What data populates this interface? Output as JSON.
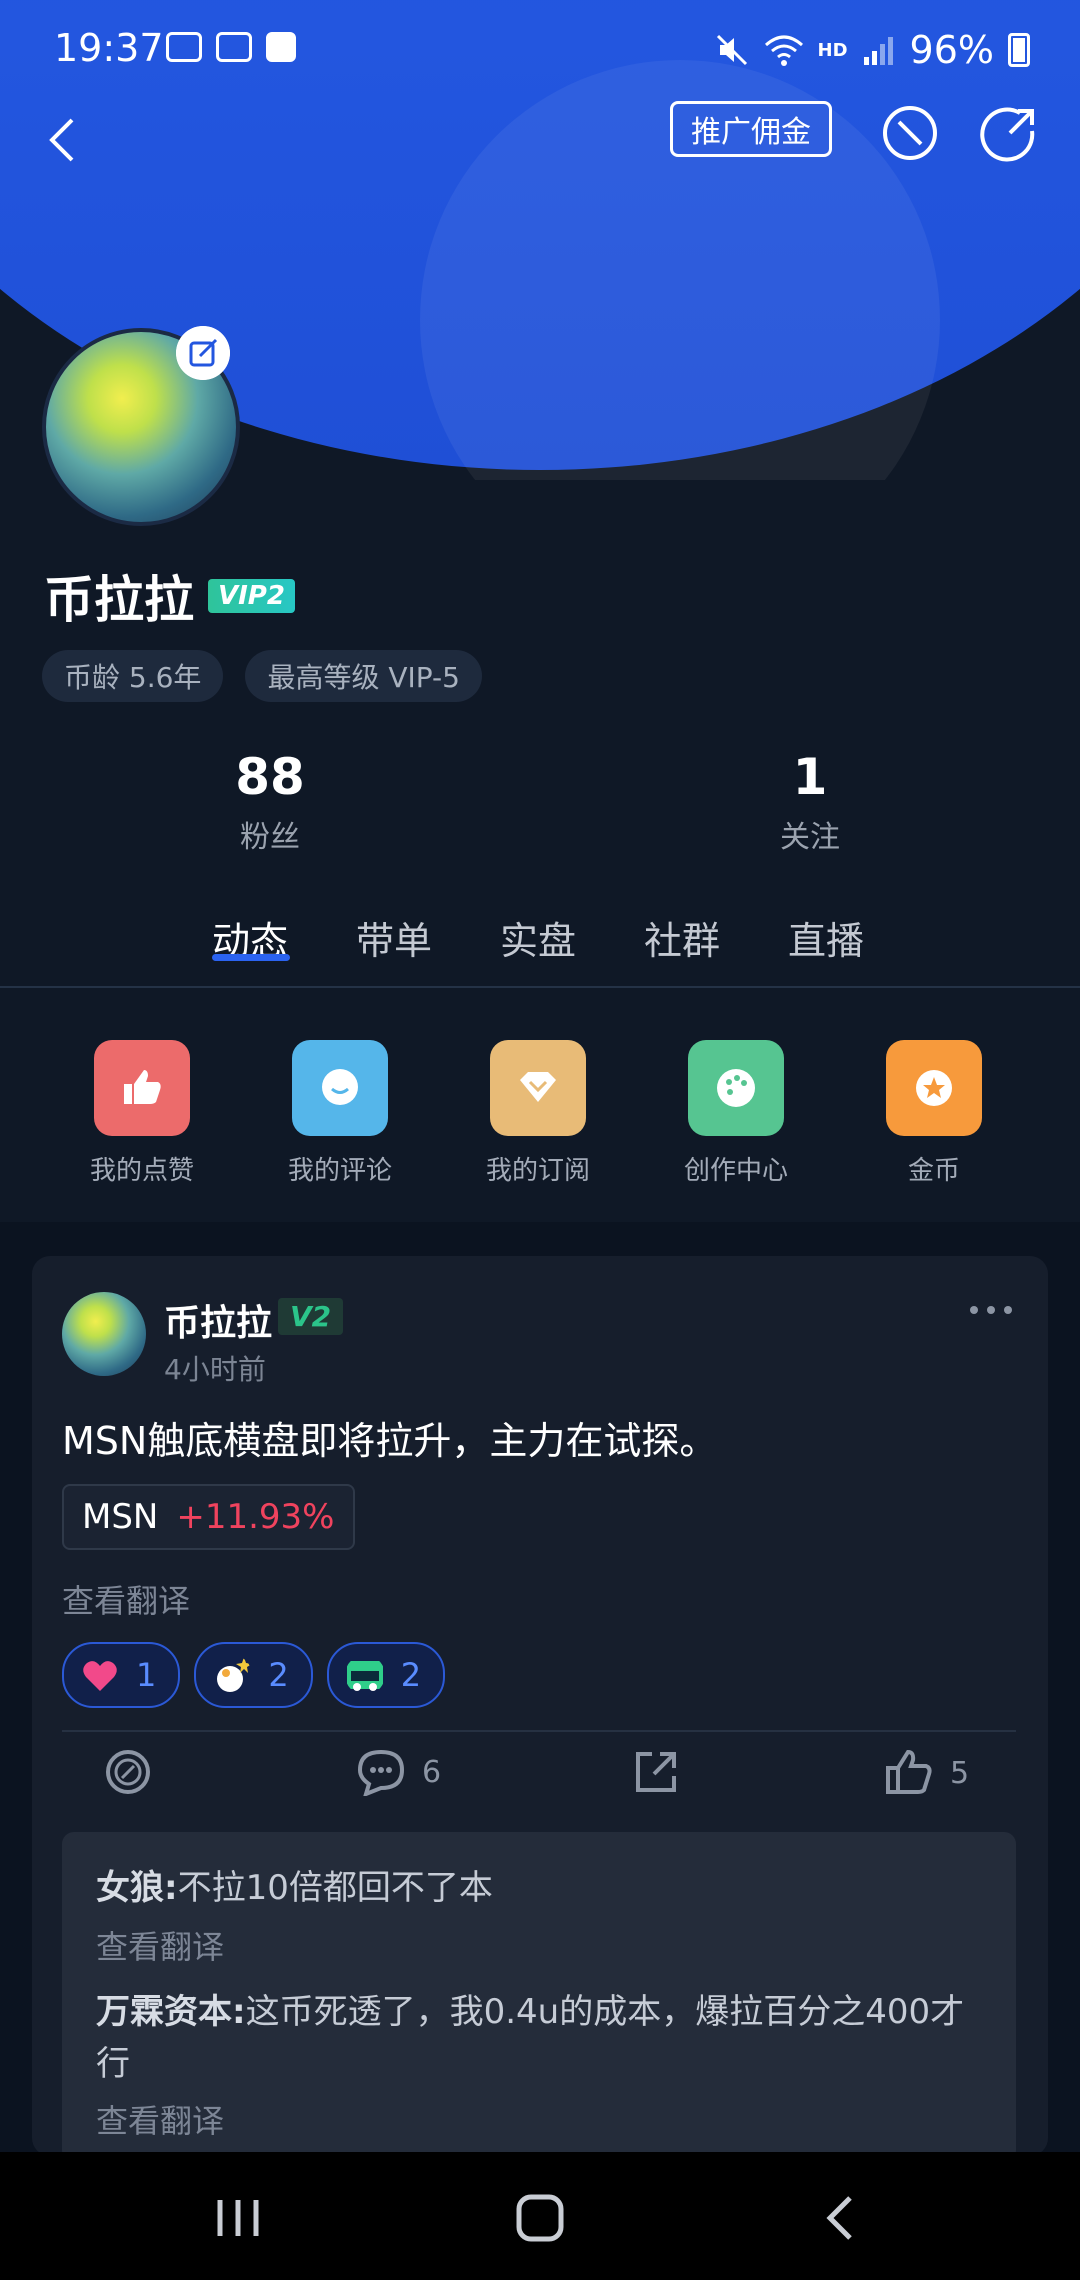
{
  "status_bar": {
    "time": "19:37",
    "hd": "HD",
    "battery": "96%"
  },
  "top_nav": {
    "promo_label": "推广佣金"
  },
  "profile": {
    "name": "币拉拉",
    "vip_badge": "VIP2",
    "tags": [
      "币龄 5.6年",
      "最高等级 VIP-5"
    ],
    "stats": [
      {
        "value": "88",
        "label": "粉丝"
      },
      {
        "value": "1",
        "label": "关注"
      }
    ]
  },
  "tabs": [
    "动态",
    "带单",
    "实盘",
    "社群",
    "直播"
  ],
  "shortcuts": [
    {
      "label": "我的点赞",
      "color": "#ec6b6b",
      "icon": "thumbs-up-icon"
    },
    {
      "label": "我的评论",
      "color": "#55b6ea",
      "icon": "chat-bubble-icon"
    },
    {
      "label": "我的订阅",
      "color": "#e8bb77",
      "icon": "diamond-icon"
    },
    {
      "label": "创作中心",
      "color": "#56c591",
      "icon": "palette-icon"
    },
    {
      "label": "金币",
      "color": "#f79a3c",
      "icon": "coin-star-icon"
    }
  ],
  "post": {
    "author": "币拉拉",
    "badge": "V2",
    "time": "4小时前",
    "text": "MSN触底横盘即将拉升，主力在试探。",
    "ticker_symbol": "MSN",
    "ticker_change": "+11.93%",
    "translate": "查看翻译",
    "reactions": [
      {
        "icon": "heart-icon",
        "count": "1"
      },
      {
        "icon": "ok-hand-icon",
        "count": "2"
      },
      {
        "icon": "hodl-sticker-icon",
        "count": "2"
      }
    ],
    "actions": {
      "comments": "6",
      "likes": "5"
    }
  },
  "comments": [
    {
      "user": "女狼:",
      "text": "不拉10倍都回不了本",
      "translate": "查看翻译"
    },
    {
      "user": "万霖资本:",
      "text": "这币死透了，我0.4u的成本，爆拉百分之400才行",
      "translate": "查看翻译"
    }
  ]
}
